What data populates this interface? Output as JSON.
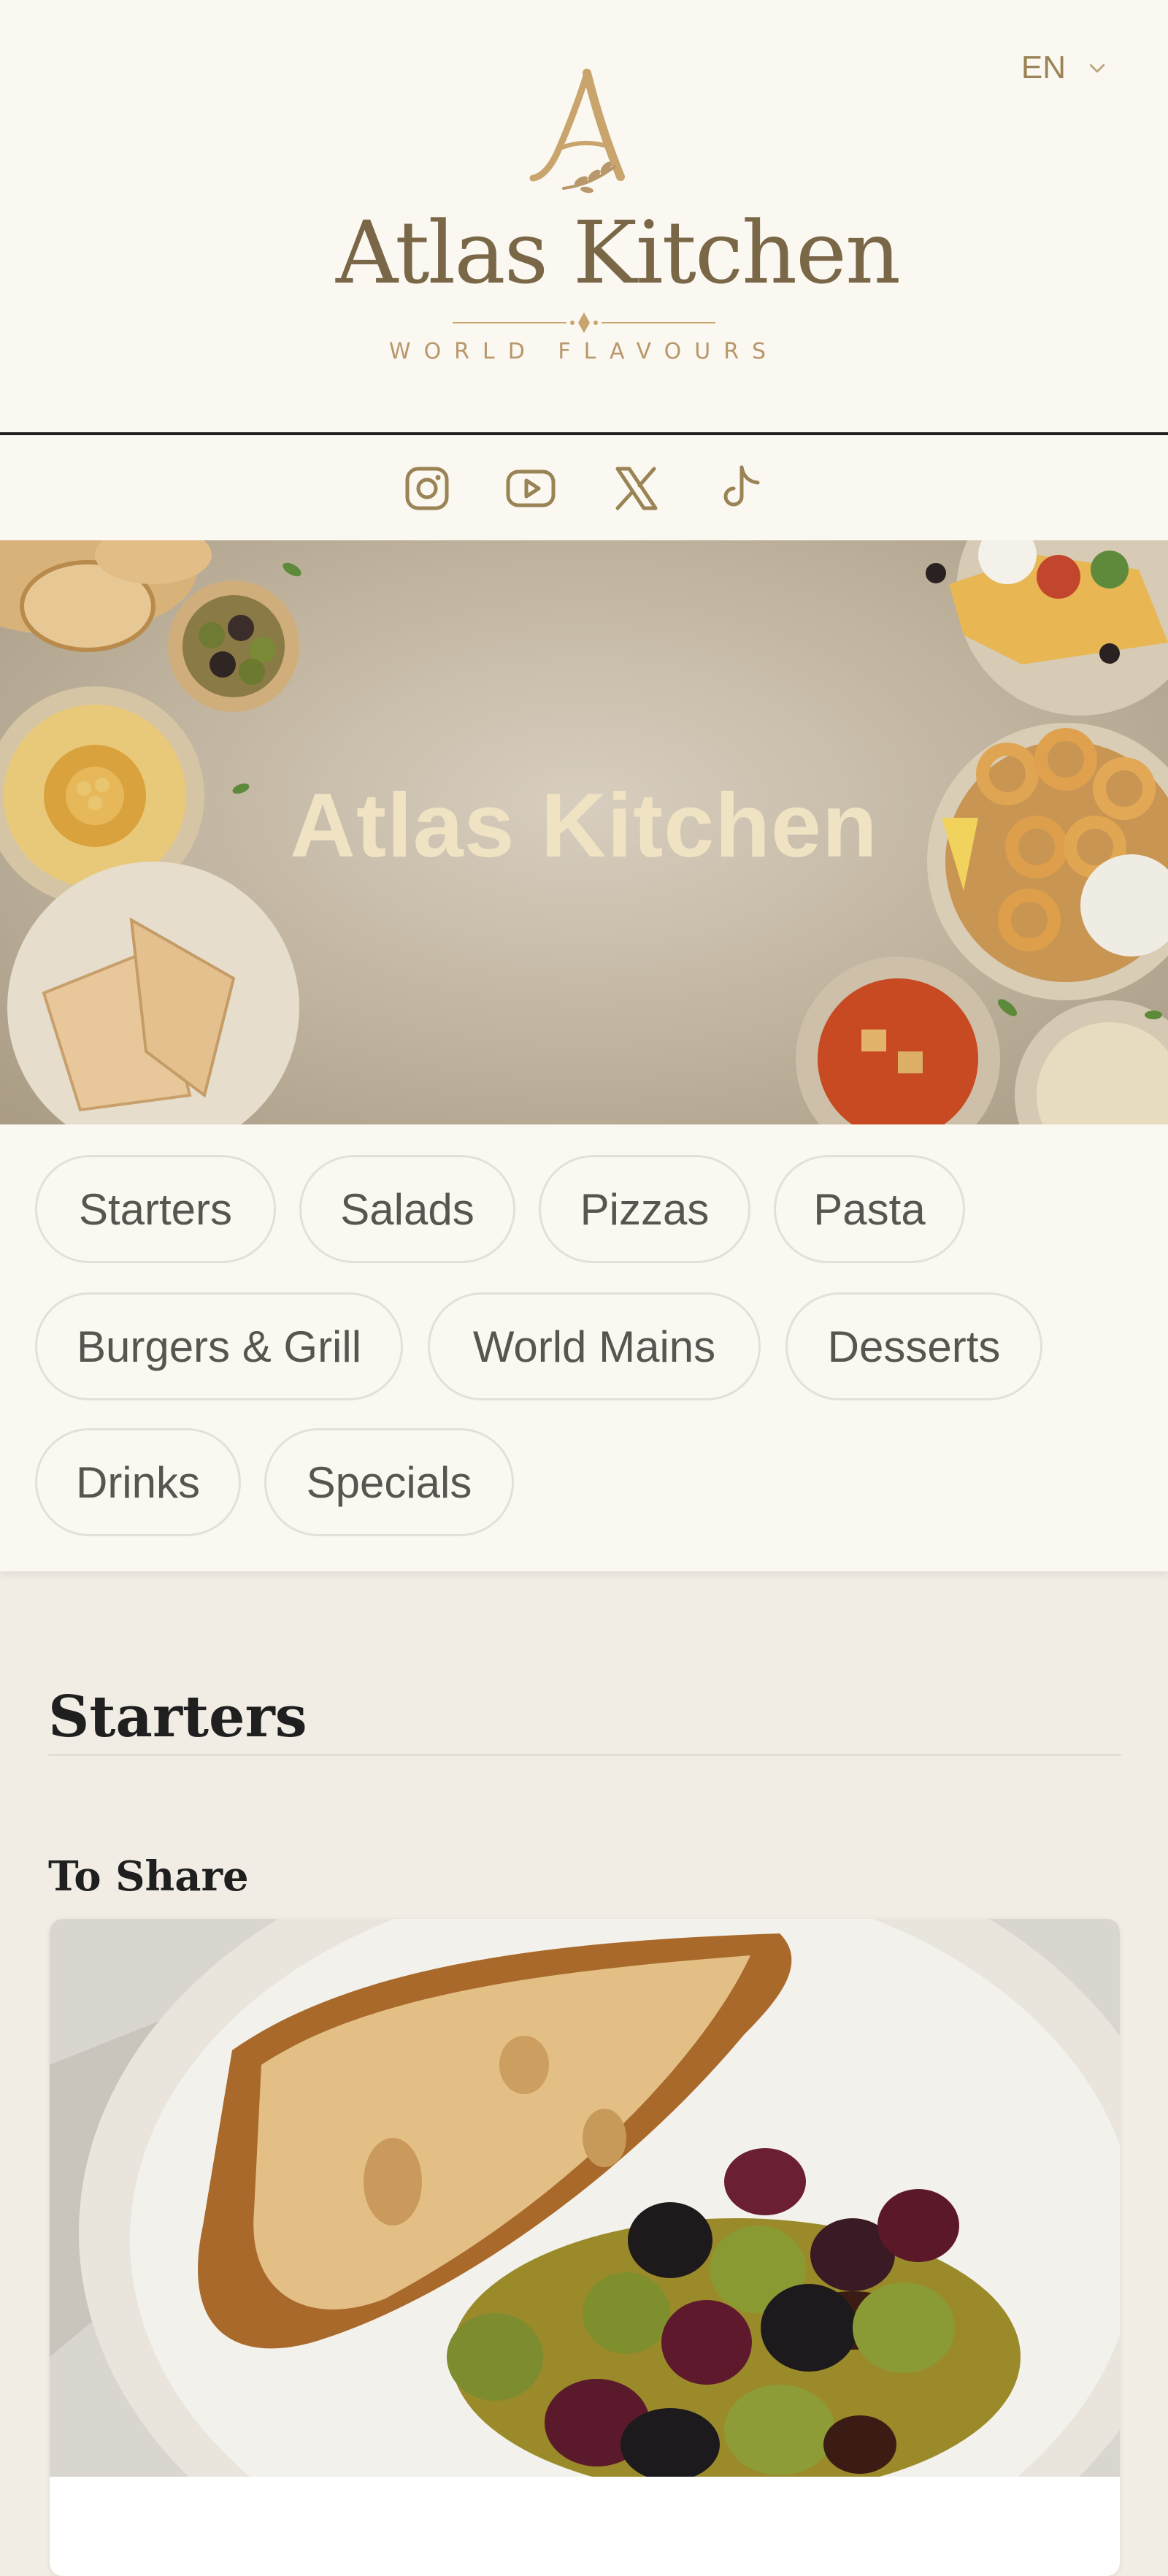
{
  "language": {
    "selected": "EN"
  },
  "brand": {
    "name": "Atlas Kitchen",
    "tagline": "WORLD FLAVOURS"
  },
  "socials": [
    "instagram-icon",
    "youtube-icon",
    "x-icon",
    "tiktok-icon"
  ],
  "hero": {
    "title": "Atlas Kitchen"
  },
  "categories": [
    "Starters",
    "Salads",
    "Pizzas",
    "Pasta",
    "Burgers & Grill",
    "World Mains",
    "Desserts",
    "Drinks",
    "Specials"
  ],
  "menu": {
    "section_title": "Starters",
    "subsection_title": "To Share"
  },
  "colors": {
    "page_bg": "#faf8f1",
    "section_bg": "#f1ede4",
    "accent_gold": "#b8976a",
    "hero_title": "#efe3c4",
    "chip_border": "#e3e0d8",
    "text_dark": "#1f1f1f"
  }
}
